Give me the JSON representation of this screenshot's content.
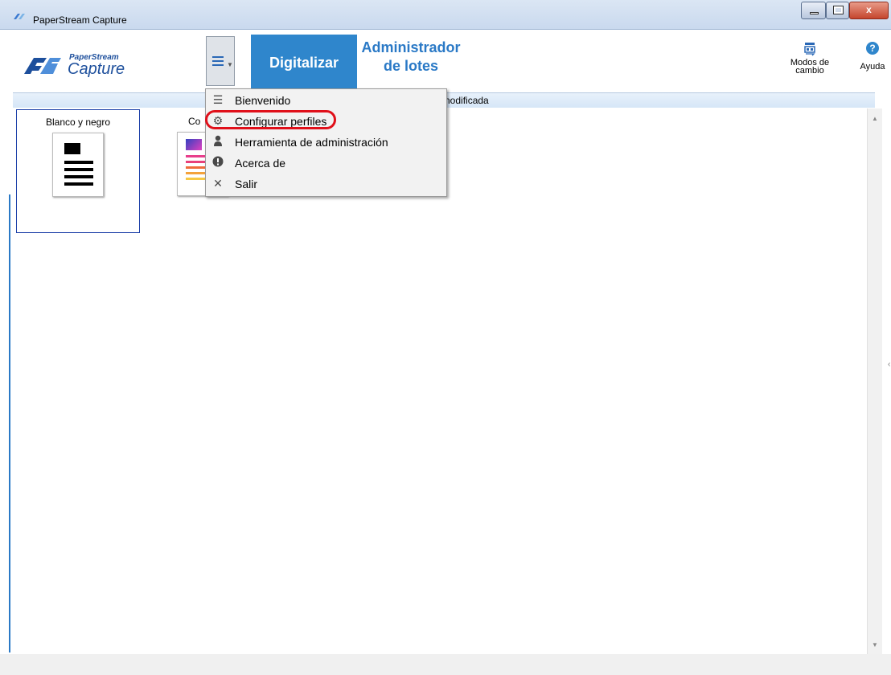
{
  "window": {
    "title": "PaperStream Capture",
    "controls": {
      "minimize": "",
      "maximize": "",
      "close": "x"
    }
  },
  "logo": {
    "brand_small": "PaperStream",
    "brand_large": "Capture"
  },
  "toolbar": {
    "tabs": [
      {
        "label": "Digitalizar",
        "active": true
      },
      {
        "label_line1": "Administrador",
        "label_line2": "de lotes",
        "active": false
      }
    ],
    "modes": {
      "line1": "Modos de",
      "line2": "cambio",
      "icon": "switch-mode-icon"
    },
    "help": {
      "label": "Ayuda",
      "glyph": "?",
      "icon": "help-icon"
    }
  },
  "profile_bar": {
    "label": "nodificada"
  },
  "profiles": [
    {
      "label": "Blanco y negro",
      "icon": "bw-document-icon",
      "selected": true
    },
    {
      "label": "Co",
      "icon": "color-document-icon",
      "selected": false
    }
  ],
  "menu": {
    "items": [
      {
        "label": "Bienvenido",
        "icon": "list-icon",
        "glyph": "☰"
      },
      {
        "label": "Configurar perfiles",
        "icon": "gear-icon",
        "glyph": "⚙"
      },
      {
        "label": "Herramienta de administración",
        "icon": "person-icon",
        "glyph": "👤"
      },
      {
        "label": "Acerca de",
        "icon": "info-icon",
        "glyph": "!"
      },
      {
        "label": "Salir",
        "icon": "close-icon",
        "glyph": "✕"
      }
    ]
  },
  "colors": {
    "accent": "#2f86cc",
    "highlight_ring": "#e0101a",
    "selected_border": "#1c3fa8"
  }
}
